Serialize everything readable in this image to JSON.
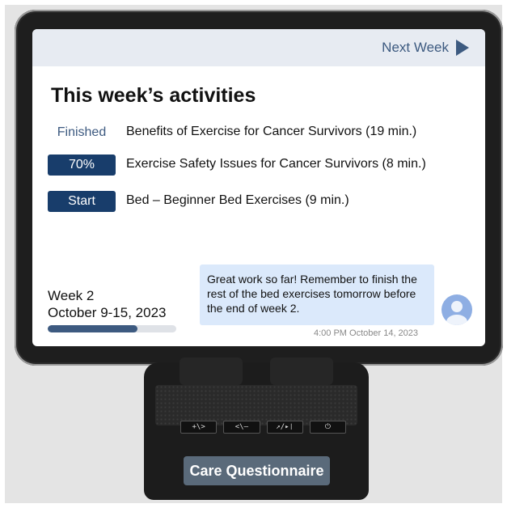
{
  "header": {
    "next_week_label": "Next Week"
  },
  "activities": {
    "title": "This week’s activities",
    "items": [
      {
        "status": "Finished",
        "title": "Benefits of Exercise for Cancer Survivors (19 min.)"
      },
      {
        "status": "70%",
        "title": "Exercise Safety Issues for Cancer Survivors (8 min.)"
      },
      {
        "status": "Start",
        "title": "Bed – Beginner Bed Exercises (9 min.)"
      }
    ]
  },
  "week": {
    "label": "Week 2",
    "dates": "October 9-15, 2023",
    "progress_fraction": 0.7
  },
  "message": {
    "text": "Great work so far!  Remember to finish the rest of the bed exercises tomorrow before the end of week 2.",
    "timestamp": "4:00 PM October 14, 2023"
  },
  "device": {
    "buttons": [
      "+\\>",
      "<\\–",
      "↗/▸❘",
      "⏻"
    ],
    "label": "Care Questionnaire"
  },
  "colors": {
    "accent": "#3d5a80",
    "button_fill": "#183d6b",
    "bubble": "#dbe9fb",
    "topbar": "#e7ebf2",
    "avatar": "#8eaee3"
  }
}
